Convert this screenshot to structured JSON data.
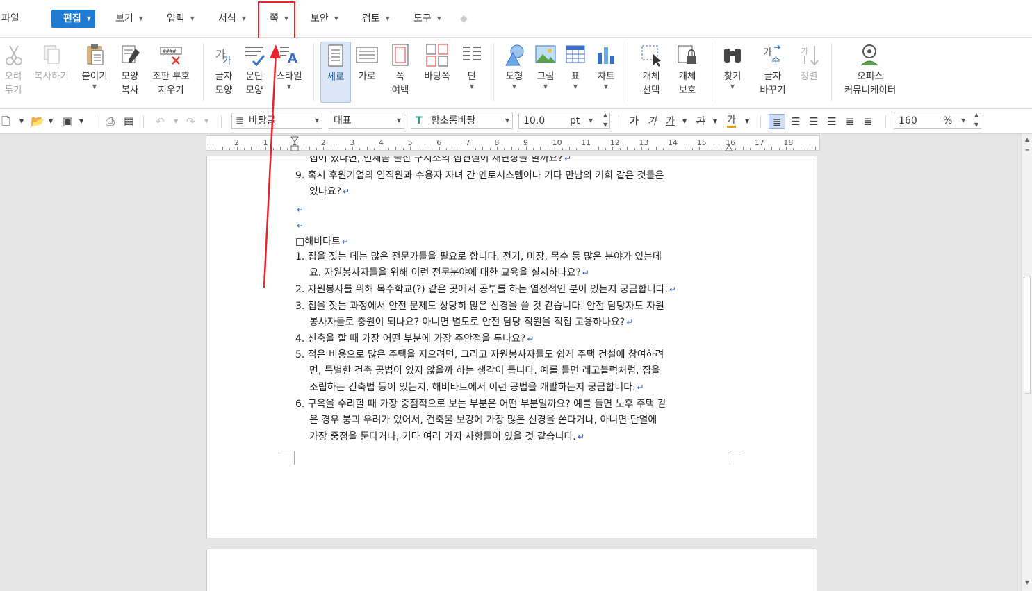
{
  "menubar": {
    "file": "파일",
    "items": [
      {
        "label": "편집",
        "active": true
      },
      {
        "label": "보기"
      },
      {
        "label": "입력"
      },
      {
        "label": "서식"
      },
      {
        "label": "쪽"
      },
      {
        "label": "보안"
      },
      {
        "label": "검토"
      },
      {
        "label": "도구"
      }
    ]
  },
  "ribbon": {
    "cut": [
      "오려",
      "두기"
    ],
    "copy": "복사하기",
    "paste": "붙이기",
    "format_painter": [
      "모양",
      "복사"
    ],
    "clear_codes": [
      "조판 부호",
      "지우기"
    ],
    "char_shape": [
      "글자",
      "모양"
    ],
    "para_shape": [
      "문단",
      "모양"
    ],
    "style": "스타일",
    "portrait": "세로",
    "landscape": "가로",
    "margin": [
      "쪽",
      "여백"
    ],
    "background": "바탕쪽",
    "columns": "단",
    "shape": "도형",
    "picture": "그림",
    "table": "표",
    "chart": "차트",
    "object_select": [
      "개체",
      "선택"
    ],
    "object_protect": [
      "개체",
      "보호"
    ],
    "find": "찾기",
    "replace": [
      "글자",
      "바꾸기"
    ],
    "sort": "정렬",
    "office_communicator": [
      "오피스",
      "커뮤니케이터"
    ]
  },
  "toolbar2": {
    "style_value": "바탕글",
    "lang_value": "대표",
    "font_value": "함초롬바탕",
    "size_value": "10.0",
    "size_unit": "pt",
    "bold": "가",
    "italic": "가",
    "underline": "가",
    "strike": "가",
    "color": "가",
    "zoom_value": "160",
    "zoom_unit": "%"
  },
  "ruler": {
    "numbers": [
      "2",
      "1",
      "1",
      "2",
      "3",
      "4",
      "5",
      "6",
      "7",
      "8",
      "9",
      "10",
      "11",
      "12",
      "13",
      "14",
      "15",
      "16",
      "17",
      "18"
    ]
  },
  "document": {
    "lines": [
      {
        "text": "섭여 있다면, 언제쯤 울산 구지소의 섭견실이 새단상을 할까요?",
        "ret": true,
        "cont": true
      },
      {
        "text": "9.  혹시 후원기업의 임직원과 수용자 자녀 간 멘토시스템이나 기타 만남의 기회 같은 것들은",
        "ret": false,
        "cont": false
      },
      {
        "text": "있나요?",
        "ret": true,
        "cont": true
      },
      {
        "text": "",
        "ret": true,
        "cont": false
      },
      {
        "text": "",
        "ret": true,
        "cont": false
      },
      {
        "text": "□해비타트",
        "ret": true,
        "cont": false
      },
      {
        "text": "1.  집을 짓는 데는 많은 전문가들을 필요로 합니다. 전기, 미장, 목수 등 많은 분야가 있는데",
        "ret": false,
        "cont": false
      },
      {
        "text": "요. 자원봉사자들을 위해 이런 전문분야에 대한 교육을 실시하나요?",
        "ret": true,
        "cont": true
      },
      {
        "text": "2.  자원봉사를 위해 목수학교(?) 같은 곳에서 공부를 하는 열정적인 분이 있는지 궁금합니다.",
        "ret": true,
        "cont": false
      },
      {
        "text": "3.  집을 짓는 과정에서 안전 문제도 상당히 많은 신경을 쓸 것 같습니다. 안전 담당자도 자원",
        "ret": false,
        "cont": false
      },
      {
        "text": "봉사자들로 충원이 되나요? 아니면 별도로 안전 담당 직원을 직접 고용하나요?",
        "ret": true,
        "cont": true
      },
      {
        "text": "4.  신축을 할 때 가장 어떤 부분에 가장 주안점을 두나요?",
        "ret": true,
        "cont": false
      },
      {
        "text": "5.  적은 비용으로 많은 주택을 지으려면, 그리고 자원봉사자들도 쉽게 주택 건설에 참여하려",
        "ret": false,
        "cont": false
      },
      {
        "text": "면, 특별한 건축 공법이 있지 않을까 하는 생각이 듭니다. 예를 들면 레고블럭처럼, 집을",
        "ret": false,
        "cont": true
      },
      {
        "text": "조립하는 건축법 등이 있는지, 해비타트에서 이런 공법을 개발하는지 궁금합니다.",
        "ret": true,
        "cont": true
      },
      {
        "text": "6.  구옥을 수리할 때 가장 중점적으로 보는 부분은 어떤 부분일까요? 예를 들면 노후 주택 같",
        "ret": false,
        "cont": false
      },
      {
        "text": "은 경우 붕괴 우려가 있어서, 건축물 보강에 가장 많은 신경을 쓴다거나, 아니면 단열에",
        "ret": false,
        "cont": true
      },
      {
        "text": "가장 중점을 둔다거나, 기타 여러 가지 사항들이 있을 것 같습니다.",
        "ret": true,
        "cont": true
      }
    ],
    "return_mark": "↵"
  },
  "colors": {
    "accent": "#1f7bd2",
    "highlight": "#e8232b"
  }
}
